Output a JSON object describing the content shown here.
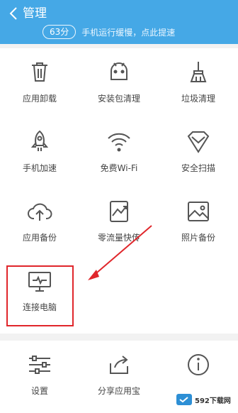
{
  "header": {
    "title": "管理",
    "score": "63分",
    "tip": "手机运行缓慢，点此提速"
  },
  "grid": [
    {
      "label": "应用卸载",
      "icon": "trash-icon"
    },
    {
      "label": "安装包清理",
      "icon": "android-icon"
    },
    {
      "label": "垃圾清理",
      "icon": "broom-icon"
    },
    {
      "label": "手机加速",
      "icon": "rocket-icon"
    },
    {
      "label": "免费Wi-Fi",
      "icon": "wifi-icon"
    },
    {
      "label": "安全扫描",
      "icon": "shield-icon"
    },
    {
      "label": "应用备份",
      "icon": "cloud-upload-icon"
    },
    {
      "label": "零流量快传",
      "icon": "transfer-icon"
    },
    {
      "label": "照片备份",
      "icon": "photo-icon"
    },
    {
      "label": "连接电脑",
      "icon": "monitor-icon"
    }
  ],
  "bottom": [
    {
      "label": "设置",
      "icon": "sliders-icon"
    },
    {
      "label": "分享应用宝",
      "icon": "share-icon"
    },
    {
      "label": "",
      "icon": "info-icon"
    }
  ],
  "watermark": {
    "text": "592下载网"
  },
  "colors": {
    "header": "#45a8e6",
    "highlight": "#e0262b",
    "icon": "#555555"
  }
}
